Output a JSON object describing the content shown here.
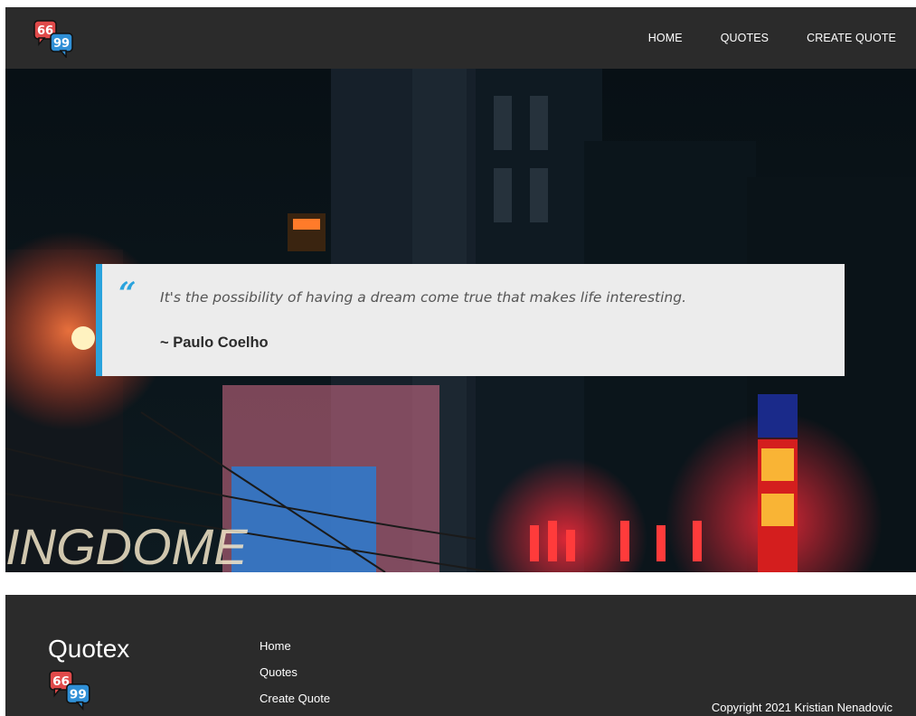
{
  "nav": {
    "logo_icon": "quote-bubbles-logo",
    "links": [
      "HOME",
      "QUOTES",
      "CREATE QUOTE"
    ]
  },
  "hero": {
    "background": "neon-city-night-photo",
    "sign_text": "INGDOME"
  },
  "quote": {
    "mark": "“",
    "text": "It's the possibility of having a dream come true that makes life interesting.",
    "author": "~ Paulo Coelho"
  },
  "footer": {
    "brand": "Quotex",
    "links": [
      "Home",
      "Quotes",
      "Create Quote"
    ],
    "copyright": "Copyright 2021 Kristian Nenadovic"
  },
  "colors": {
    "header_bg": "#2b2b2b",
    "accent": "#2aa3dd",
    "card_bg": "#ececec",
    "logo_red": "#e04a4a",
    "logo_blue": "#2f8fd6"
  }
}
